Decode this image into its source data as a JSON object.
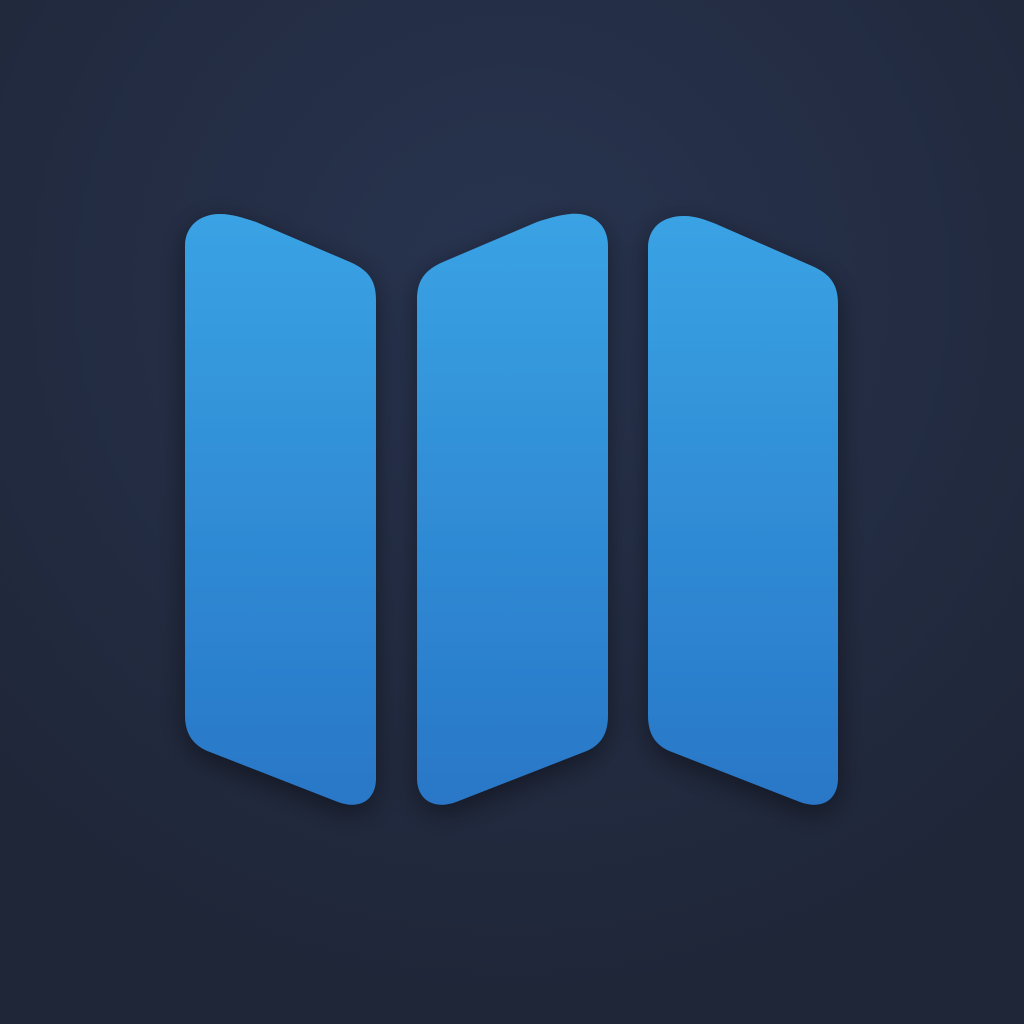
{
  "icon": {
    "name": "three-panel-map-icon",
    "background_color": "#222b3e",
    "background_glow_color": "#283450",
    "panel_color_top": "#39a2e3",
    "panel_color_bottom": "#2a78c8",
    "panel_count": 3
  }
}
